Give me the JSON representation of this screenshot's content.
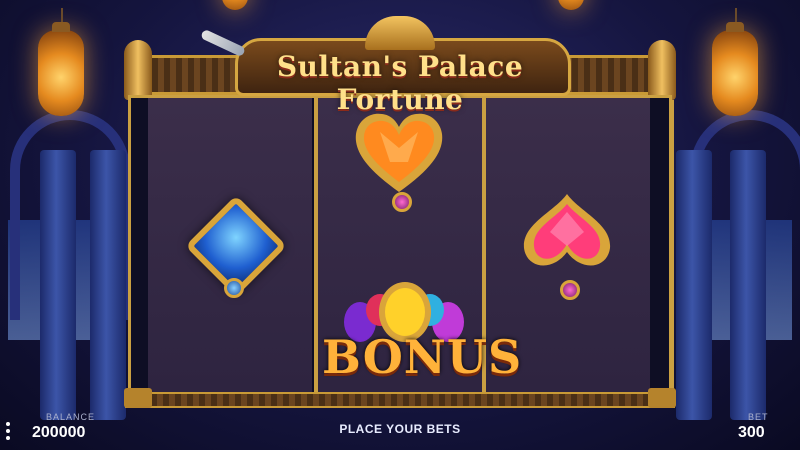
{
  "game": {
    "title": "Sultan's Palace Fortune"
  },
  "reels": {
    "symbols": [
      "blue-diamond-gem",
      "orange-heart-gem",
      "pink-spade-gem",
      "bonus-gems"
    ],
    "bonus_label": "BONUS"
  },
  "hud": {
    "balance_label": "BALANCE",
    "balance_value": "200000",
    "status_text": "PLACE YOUR BETS",
    "bet_label": "BET",
    "bet_value": "300"
  },
  "colors": {
    "frame_gold": "#caa042",
    "reel_background": "#3b2e4a",
    "title_gold": "#ffe08a"
  }
}
